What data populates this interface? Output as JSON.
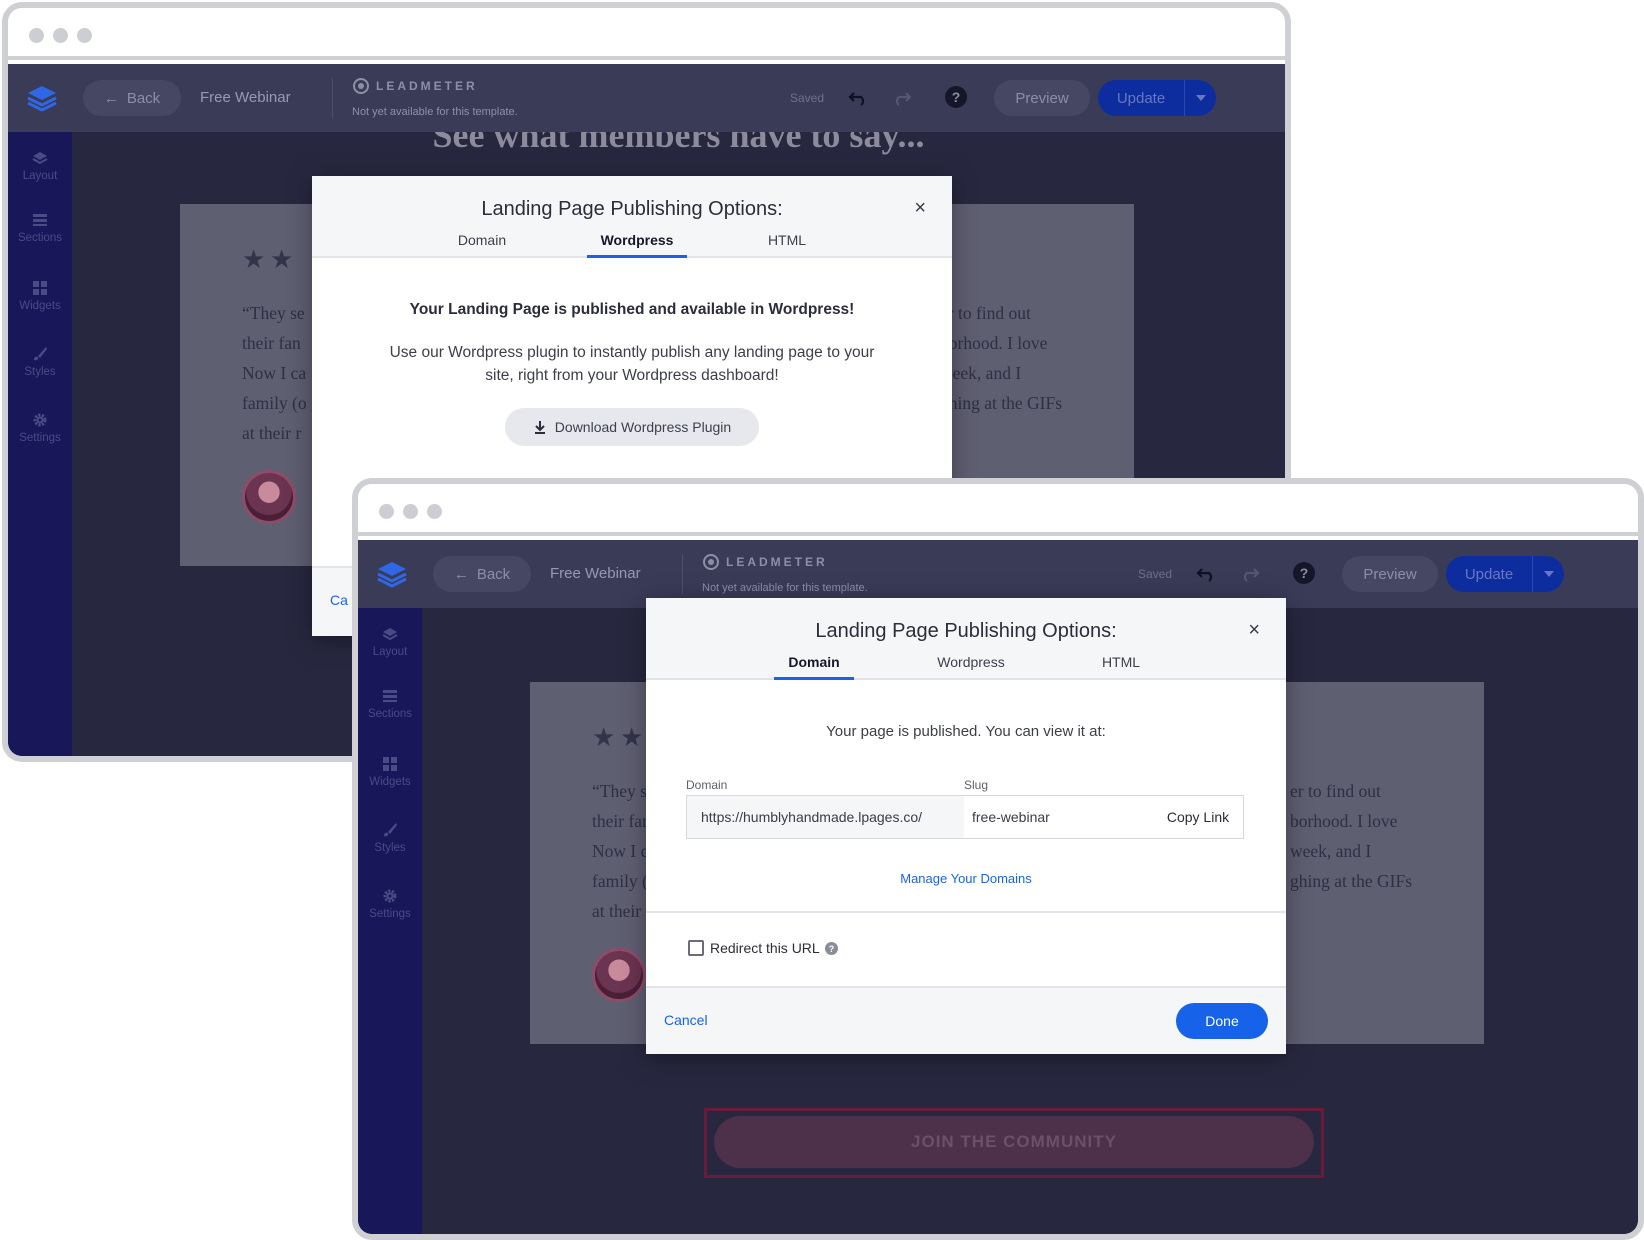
{
  "app": {
    "back_label": "Back",
    "page_name": "Free Webinar",
    "brand": "LEADMETER",
    "brand_note": "Not yet available for this template.",
    "saved": "Saved",
    "help": "?",
    "preview": "Preview",
    "update": "Update"
  },
  "sidebar": {
    "items": [
      {
        "label": "Layout",
        "icon": "layers-icon"
      },
      {
        "label": "Sections",
        "icon": "sections-icon"
      },
      {
        "label": "Widgets",
        "icon": "widgets-icon"
      },
      {
        "label": "Styles",
        "icon": "brush-icon"
      },
      {
        "label": "Settings",
        "icon": "gear-icon"
      }
    ]
  },
  "canvas": {
    "headline": "See what members have to say...",
    "quote_left": "“They se\ntheir fan\nNow I ca\nfamily (o\nat their r",
    "quote_right": "er to find out\nborhood. I love\nweek, and I\nghing at the GIFs",
    "join_button": "JOIN THE COMMUNITY"
  },
  "modal": {
    "title": "Landing Page Publishing Options:",
    "close": "×",
    "tabs": [
      "Domain",
      "Wordpress",
      "HTML"
    ]
  },
  "wordpress_panel": {
    "title": "Your Landing Page is published and available in Wordpress!",
    "text_line1": "Use our Wordpress plugin to instantly publish any landing page to your",
    "text_line2": "site, right from your Wordpress dashboard!",
    "download_button": "Download Wordpress Plugin",
    "cancel_partial": "Ca"
  },
  "domain_panel": {
    "intro": "Your page is published. You can view it at:",
    "domain_label": "Domain",
    "domain_value": "https://humblyhandmade.lpages.co/",
    "slug_label": "Slug",
    "slug_value": "free-webinar",
    "copy_link": "Copy Link",
    "manage_domains": "Manage Your Domains",
    "redirect_label": "Redirect this URL",
    "redirect_checked": false,
    "cancel": "Cancel",
    "done": "Done"
  },
  "colors": {
    "accent": "#1662e9",
    "sidebar": "#17175a",
    "topbar": "#3a3b57",
    "frame": "#cfd0d4"
  }
}
